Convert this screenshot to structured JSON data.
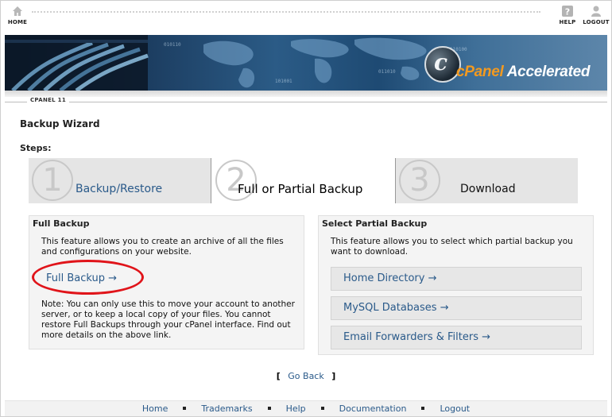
{
  "topbar": {
    "home_label": "HOME",
    "help_label": "HELP",
    "logout_label": "LOGOUT"
  },
  "brand": {
    "logo_letter": "c",
    "cpanel": "cPanel",
    "accelerated": "Accelerated",
    "version_tag": "CPANEL 11"
  },
  "page": {
    "title": "Backup Wizard",
    "steps_label": "Steps:"
  },
  "steps": [
    {
      "number": "1",
      "label": "Backup/Restore",
      "active": false
    },
    {
      "number": "2",
      "label": "Full or Partial Backup",
      "active": true
    },
    {
      "number": "3",
      "label": "Download",
      "active": false
    }
  ],
  "full_backup": {
    "heading": "Full Backup",
    "description": "This feature allows you to create an archive of all the files and configurations on your website.",
    "link_label": "Full Backup →",
    "note": "Note: You can only use this to move your account to another server, or to keep a local copy of your files. You cannot restore Full Backups through your cPanel interface. Find out more details on the above link."
  },
  "partial_backup": {
    "heading": "Select Partial Backup",
    "description": "This feature allows you to select which partial backup you want to download.",
    "buttons": [
      {
        "label": "Home Directory →"
      },
      {
        "label": "MySQL Databases →"
      },
      {
        "label": "Email Forwarders & Filters →"
      }
    ]
  },
  "navigation": {
    "bracket_open": "[",
    "go_back": "Go Back",
    "bracket_close": "]"
  },
  "footer": {
    "links": [
      "Home",
      "Trademarks",
      "Help",
      "Documentation",
      "Logout"
    ]
  },
  "colors": {
    "link": "#2a5a8a",
    "highlight": "#e0141a",
    "brand_orange": "#f39a1f"
  }
}
